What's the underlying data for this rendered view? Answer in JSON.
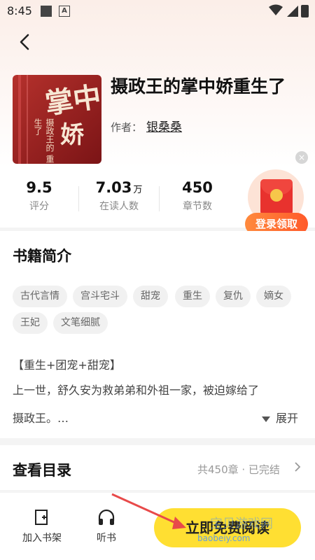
{
  "status_bar": {
    "time": "8:45"
  },
  "book": {
    "title": "摄政王的掌中娇重生了",
    "author_label": "作者：",
    "author": "银桑桑",
    "cover": {
      "main_text": "掌中",
      "sub_text": "娇",
      "vertical_text": "摄政王的 重生了"
    }
  },
  "stats": [
    {
      "value": "9.5",
      "unit": "",
      "label": "评分"
    },
    {
      "value": "7.03",
      "unit": "万",
      "label": "在读人数"
    },
    {
      "value": "450",
      "unit": "",
      "label": "章节数"
    }
  ],
  "promo": {
    "button_label": "登录领取",
    "close": "×"
  },
  "intro": {
    "heading": "书籍简介",
    "tags": [
      "古代言情",
      "宫斗宅斗",
      "甜宠",
      "重生",
      "复仇",
      "嫡女",
      "王妃",
      "文笔细腻"
    ],
    "line1": "【重生+团宠+甜宠】",
    "line2": "上一世，舒久安为救弟弟和外祖一家，被迫嫁给了",
    "line3": "摄政王。…",
    "expand_label": "展开"
  },
  "toc": {
    "heading": "查看目录",
    "meta": "共450章 · 已完结"
  },
  "bottom_bar": {
    "add_shelf": "加入书架",
    "listen": "听书",
    "read_now": "立即免费阅读"
  },
  "watermark": {
    "site": "宝贝游戏网",
    "url": "baobeiy.com"
  },
  "colors": {
    "accent_yellow": "#ffdf32",
    "promo_orange": "#ff6a30",
    "arrow_red": "#e84a4a"
  }
}
